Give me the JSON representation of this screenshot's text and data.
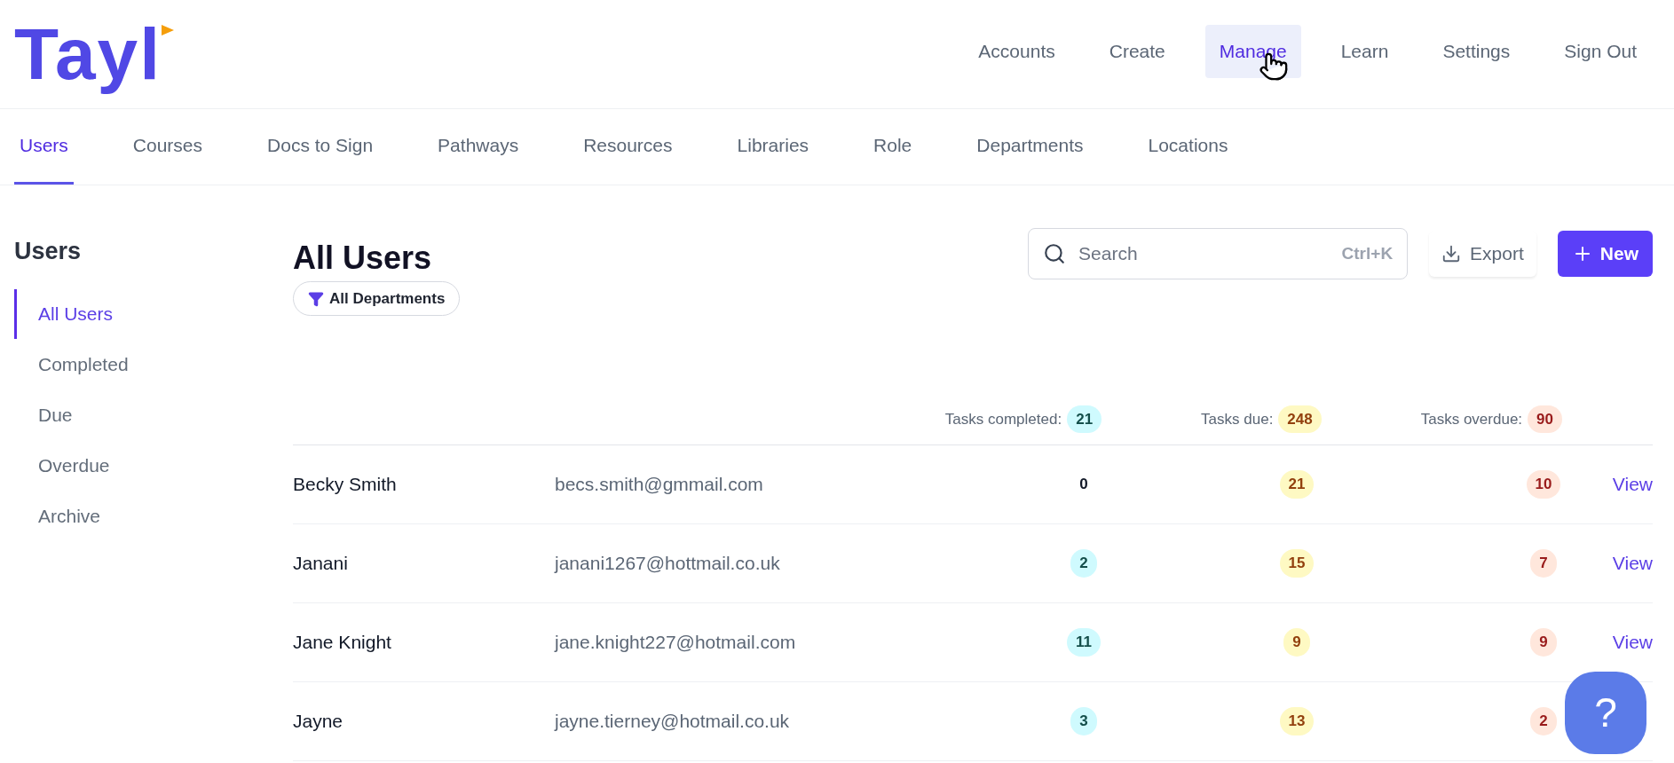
{
  "logo": "Tayl",
  "top_nav": [
    {
      "label": "Accounts",
      "selected": false
    },
    {
      "label": "Create",
      "selected": false
    },
    {
      "label": "Manage",
      "selected": true
    },
    {
      "label": "Learn",
      "selected": false
    },
    {
      "label": "Settings",
      "selected": false
    },
    {
      "label": "Sign Out",
      "selected": false
    }
  ],
  "tabs": [
    {
      "label": "Users",
      "selected": true
    },
    {
      "label": "Courses",
      "selected": false
    },
    {
      "label": "Docs to Sign",
      "selected": false
    },
    {
      "label": "Pathways",
      "selected": false
    },
    {
      "label": "Resources",
      "selected": false
    },
    {
      "label": "Libraries",
      "selected": false
    },
    {
      "label": "Role",
      "selected": false
    },
    {
      "label": "Departments",
      "selected": false
    },
    {
      "label": "Locations",
      "selected": false
    }
  ],
  "sidebar": {
    "title": "Users",
    "items": [
      {
        "label": "All Users",
        "selected": true
      },
      {
        "label": "Completed",
        "selected": false
      },
      {
        "label": "Due",
        "selected": false
      },
      {
        "label": "Overdue",
        "selected": false
      },
      {
        "label": "Archive",
        "selected": false
      }
    ]
  },
  "page_title": "All Users",
  "filter": "All Departments",
  "search": {
    "placeholder": "Search",
    "shortcut": "Ctrl+K"
  },
  "export_button": "Export",
  "new_button": "New",
  "summary": [
    {
      "label": "Tasks completed:",
      "value": "21",
      "kind": "completed"
    },
    {
      "label": "Tasks due:",
      "value": "248",
      "kind": "due"
    },
    {
      "label": "Tasks overdue:",
      "value": "90",
      "kind": "overdue"
    }
  ],
  "rows": [
    {
      "name": "Becky Smith",
      "email": "becs.smith@gmmail.com",
      "completed": {
        "value": "0",
        "pill": false
      },
      "due": {
        "value": "21",
        "pill": true
      },
      "overdue": {
        "value": "10",
        "pill": true
      },
      "action": "View"
    },
    {
      "name": "Janani",
      "email": "janani1267@hottmail.co.uk",
      "completed": {
        "value": "2",
        "pill": true
      },
      "due": {
        "value": "15",
        "pill": true
      },
      "overdue": {
        "value": "7",
        "pill": true
      },
      "action": "View"
    },
    {
      "name": "Jane Knight",
      "email": "jane.knight227@hotmail.com",
      "completed": {
        "value": "11",
        "pill": true
      },
      "due": {
        "value": "9",
        "pill": true
      },
      "overdue": {
        "value": "9",
        "pill": true
      },
      "action": "View"
    },
    {
      "name": "Jayne",
      "email": "jayne.tierney@hotmail.co.uk",
      "completed": {
        "value": "3",
        "pill": true
      },
      "due": {
        "value": "13",
        "pill": true
      },
      "overdue": {
        "value": "2",
        "pill": true
      }
    }
  ],
  "help_button": "?"
}
